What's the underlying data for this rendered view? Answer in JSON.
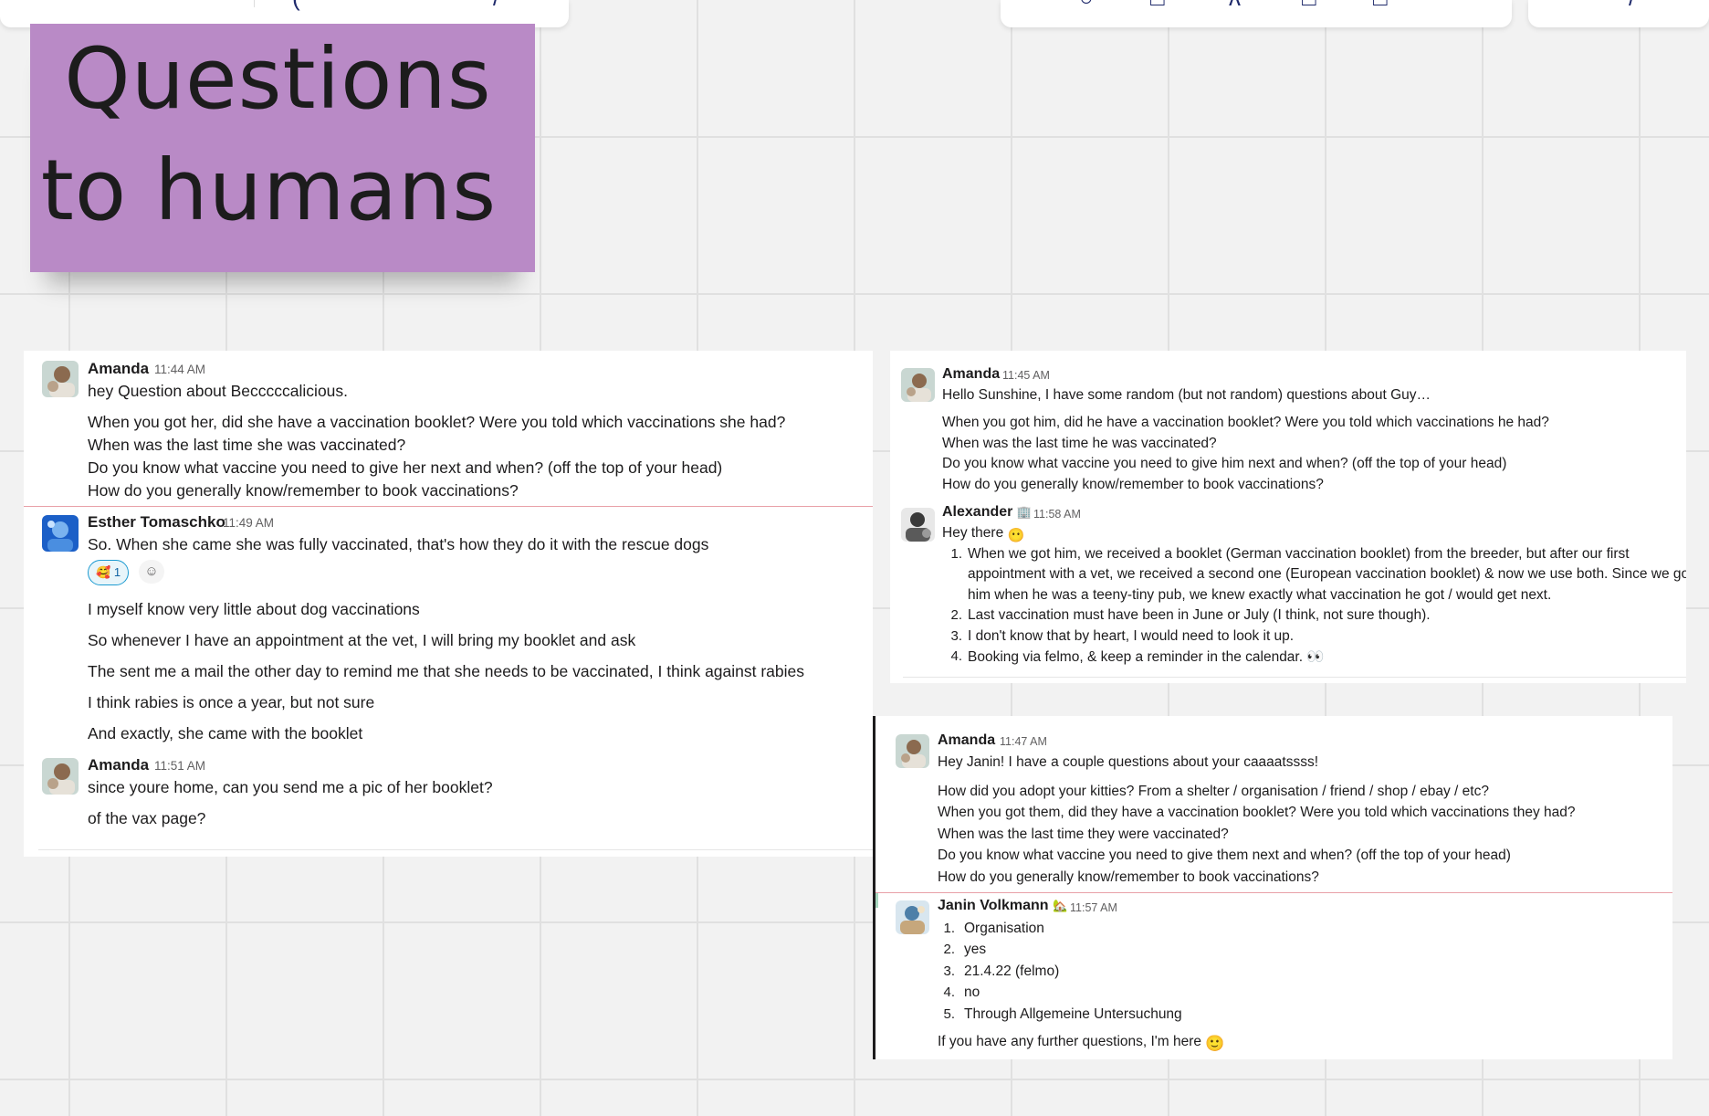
{
  "board": {
    "sticky_note": {
      "lines": [
        "Questions",
        "to humans"
      ],
      "color": "#b98ac6"
    }
  },
  "toolbar_icons": [
    "undo-icon",
    "frame-icon",
    "pen-icon",
    "card-icon",
    "upload-icon",
    "more-icon"
  ],
  "left_chat": {
    "messages": [
      {
        "author": "Amanda",
        "time": "11:44 AM",
        "lines": [
          "hey Question about Becccccalicious.",
          "When you got her, did she have a vaccination booklet? Were you told which vaccinations she had?",
          "When was the last time she was vaccinated?",
          "Do you know what vaccine you need to give her next and when? (off the top of your head)",
          "How do you generally know/remember to book vaccinations?"
        ]
      },
      {
        "author": "Esther Tomaschko",
        "time": "11:49 AM",
        "lines": [
          "So. When she came she was fully vaccinated, that's how they do it with the rescue dogs",
          "I myself know very little about dog vaccinations",
          "So whenever I have an appointment at the vet, I will bring my booklet and ask",
          "The sent me a mail the other day to remind me that she needs to be vaccinated, I think against rabies",
          "I think rabies is once a year, but not sure",
          "And exactly, she came with the booklet"
        ],
        "reaction": {
          "emoji": "🥰",
          "count": "1"
        }
      },
      {
        "author": "Amanda",
        "time": "11:51 AM",
        "lines": [
          "since youre home, can you send me a pic of her booklet?",
          "of the vax page?"
        ]
      }
    ]
  },
  "right_top_chat": {
    "messages": [
      {
        "author": "Amanda",
        "time": "11:45 AM",
        "lines": [
          "Hello Sunshine, I have some random (but not random) questions about Guy…",
          "When you got him, did he have a vaccination booklet? Were you told which vaccinations he had?",
          "When was the last time he was vaccinated?",
          "Do you know what vaccine you need to give him next and when? (off the top of your head)",
          "How do you generally know/remember to book vaccinations?"
        ]
      },
      {
        "author": "Alexander",
        "status_emoji": "🏢",
        "time": "11:58 AM",
        "greeting": "Hey there",
        "greeting_emoji": "😶",
        "list": [
          {
            "num": "1.",
            "lines": [
              "When we got him, we received a booklet (German vaccination booklet) from the breeder, but after our first",
              "appointment with a vet, we received a second one (European vaccination booklet) & now we use both. Since we got",
              "him when he was a teeny-tiny pub, we knew exactly what vaccination he got / would get next."
            ]
          },
          {
            "num": "2.",
            "lines": [
              "Last vaccination must have been in June or July (I think, not sure though)."
            ]
          },
          {
            "num": "3.",
            "lines": [
              "I don't know that by heart, I would need to look it up."
            ]
          },
          {
            "num": "4.",
            "lines": [
              "Booking via felmo, & keep a reminder in the calendar. 👀"
            ]
          }
        ]
      }
    ]
  },
  "right_bottom_chat": {
    "messages": [
      {
        "author": "Amanda",
        "time": "11:47 AM",
        "lines": [
          "Hey Janin! I have a couple questions about your caaaatssss!",
          "How did you adopt your kitties? From a shelter / organisation / friend / shop / ebay / etc?",
          "When you got them, did they have a vaccination booklet? Were you told which vaccinations they had?",
          "When was the last time they were vaccinated?",
          "Do you know what vaccine you need to give them next and when? (off the top of your head)",
          "How do you generally know/remember to book vaccinations?"
        ]
      },
      {
        "author": "Janin Volkmann",
        "status_emoji": "🏡",
        "time": "11:57 AM",
        "list": [
          {
            "num": "1.",
            "text": "Organisation"
          },
          {
            "num": "2.",
            "text": "yes"
          },
          {
            "num": "3.",
            "text": "21.4.22 (felmo)"
          },
          {
            "num": "4.",
            "text": "no"
          },
          {
            "num": "5.",
            "text": "Through Allgemeine Untersuchung"
          }
        ],
        "closing": "If you have any further questions, I'm here",
        "closing_emoji": "🙂"
      }
    ]
  }
}
